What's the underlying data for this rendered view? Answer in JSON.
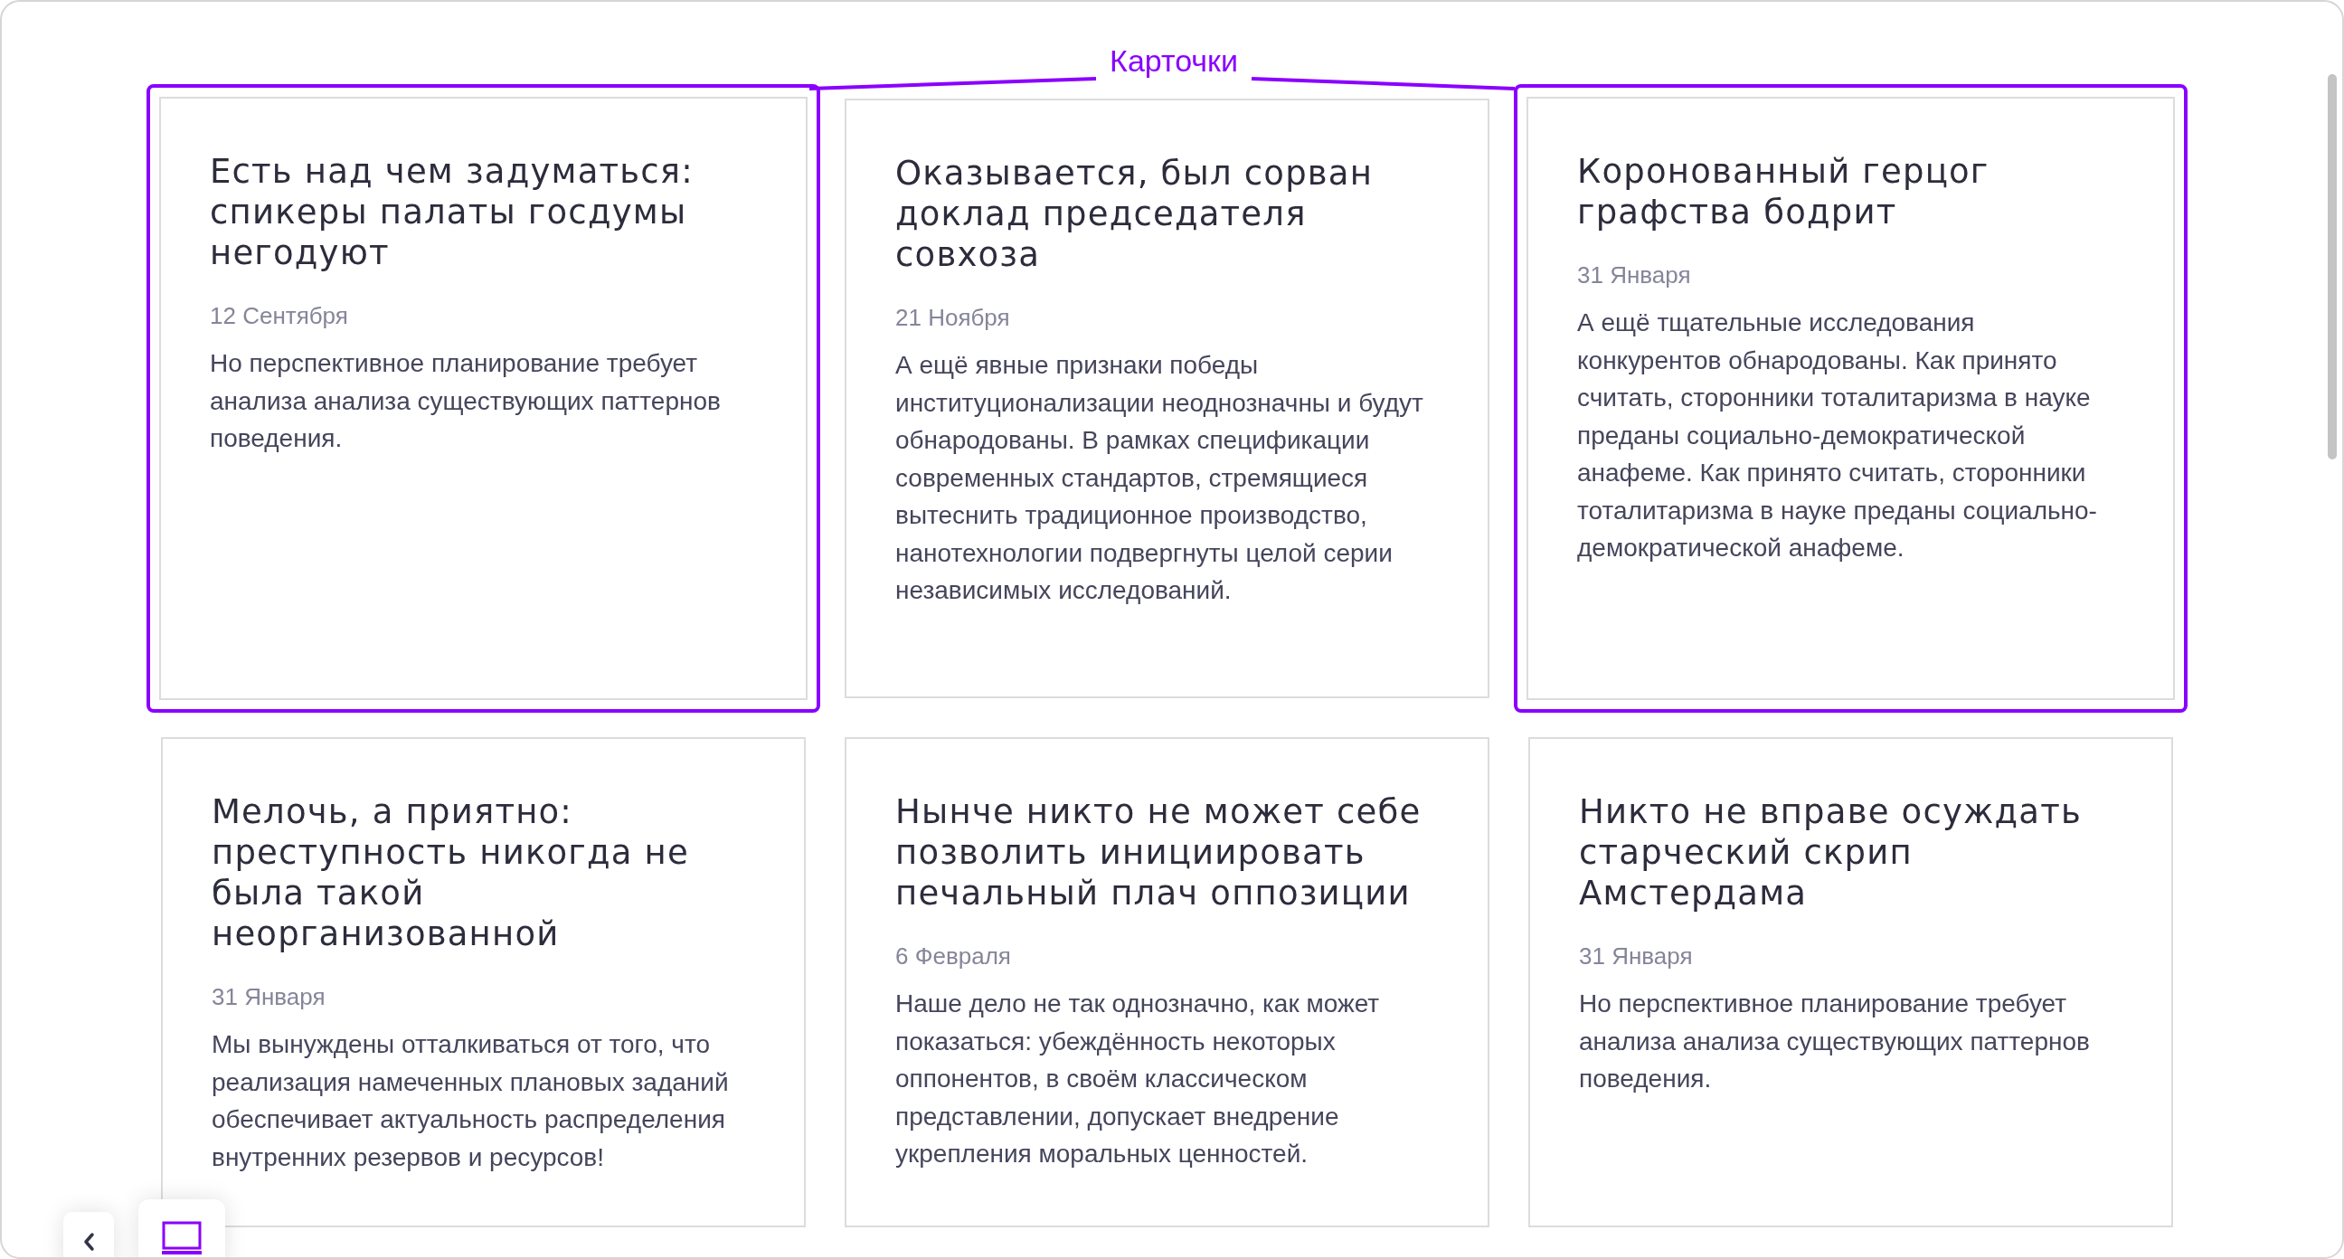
{
  "annotation": {
    "label": "Карточки"
  },
  "cards": [
    {
      "title": "Есть над чем задуматься: спикеры палаты госдумы негодуют",
      "date": "12 Сентября",
      "text": "Но перспективное планирование требует анализа анализа существующих паттернов поведения.",
      "highlighted": true
    },
    {
      "title": "Оказывается, был сорван доклад председателя совхоза",
      "date": "21 Ноября",
      "text": "А ещё явные признаки победы институционализации неоднозначны и будут обнародованы. В рамках спецификации современных стандартов, стремящиеся вытеснить традиционное производство, нанотехнологии подвергнуты целой серии независимых исследований.",
      "highlighted": false
    },
    {
      "title": "Коронованный герцог графства бодрит",
      "date": "31 Января",
      "text": "А ещё тщательные исследования конкурентов обнародованы. Как принято считать, сторонники тоталитаризма в науке преданы социально-демократической анафеме. Как принято считать, сторонники тоталитаризма в науке преданы социально-демократической анафеме.",
      "highlighted": true
    },
    {
      "title": "Мелочь, а приятно: преступность никогда не была такой неорганизованной",
      "date": "31 Января",
      "text": "Мы вынуждены отталкиваться от того, что реализация намеченных плановых заданий обеспечивает актуальность распределения внутренних резервов и ресурсов!",
      "highlighted": false
    },
    {
      "title": "Нынче никто не может себе позволить инициировать печальный плач оппозиции",
      "date": "6 Февраля",
      "text": "Наше дело не так однозначно, как может показаться: убеждённость некоторых оппонентов, в своём классическом представлении, допускает внедрение укрепления моральных ценностей.",
      "highlighted": false
    },
    {
      "title": "Никто не вправе осуждать старческий скрип Амстердама",
      "date": "31 Января",
      "text": "Но перспективное планирование требует анализа анализа существующих паттернов поведения.",
      "highlighted": false
    }
  ]
}
